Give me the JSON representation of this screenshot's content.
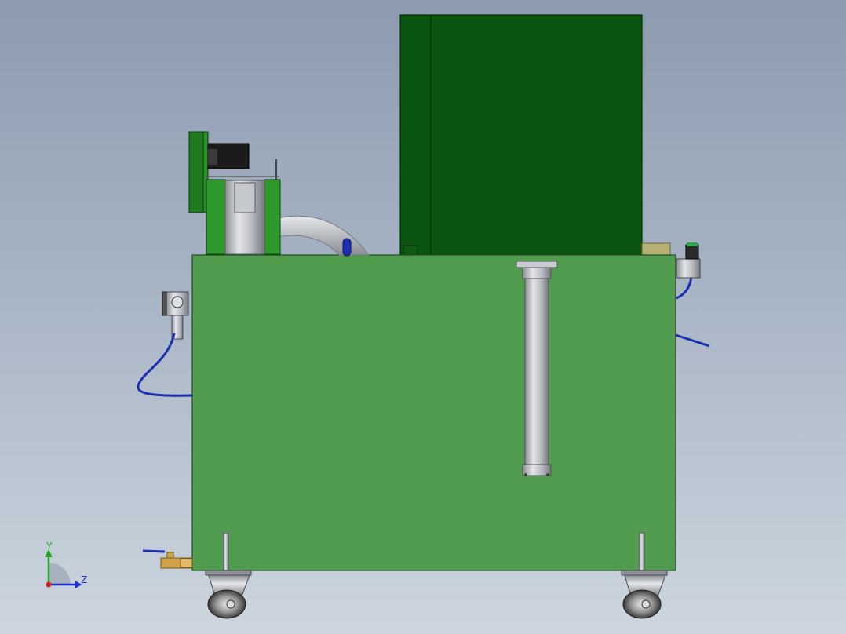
{
  "viewport": {
    "background_top": "#8d9bb0",
    "background_bottom": "#cdd6df"
  },
  "model": {
    "body_color": "#529c4f",
    "dark_enclosure_color": "#0a5410",
    "motor_color": "#1f7a1f",
    "hose_color": "#1c2fb0",
    "metal_color": "#b9bcc2"
  },
  "triad": {
    "y_label": "Y",
    "z_label": "Z",
    "y_axis_color": "#27a327",
    "z_axis_color": "#2233cc",
    "x_axis_color": "#cc2222"
  }
}
